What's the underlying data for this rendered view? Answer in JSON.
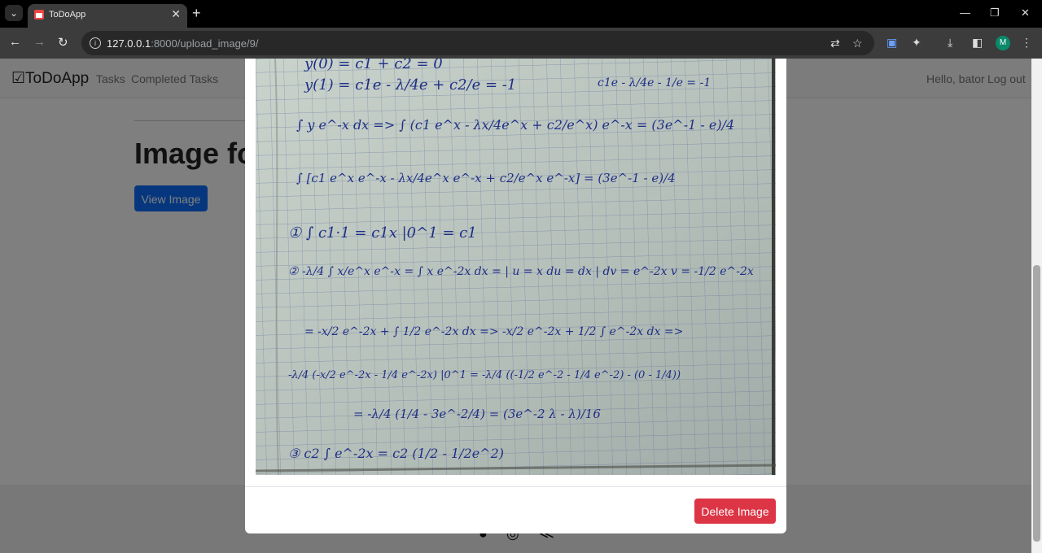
{
  "browser": {
    "tab_title": "ToDoApp",
    "url_host": "127.0.0.1",
    "url_path": ":8000/upload_image/9/",
    "profile_initial": "M"
  },
  "navbar": {
    "brand": "ToDoApp",
    "links": [
      "Tasks",
      "Completed Tasks"
    ],
    "greeting": "Hello, bator",
    "logout": "Log out"
  },
  "main": {
    "heading": "Image fo",
    "view_button": "View Image"
  },
  "modal": {
    "image_subject": "handwritten math notes on grid paper",
    "delete_button": "Delete Image",
    "notes": [
      "y(0) = c1 + c2 = 0",
      "y(1) = c1e - λ/4e + c2/e = -1",
      "c1e - λ/4e - 1/e = -1",
      "∫ y e^-x dx => ∫ (c1 e^x - λx/4e^x + c2/e^x) e^-x = (3e^-1 - e)/4",
      "∫ [c1 e^x e^-x - λx/4e^x e^-x + c2/e^x e^-x] = (3e^-1 - e)/4",
      "① ∫ c1·1 = c1x |0^1 = c1",
      "② -λ/4 ∫ x/e^x e^-x = ∫ x e^-2x dx = | u = x   du = dx | dv = e^-2x   v = -1/2 e^-2x",
      "= -x/2 e^-2x + ∫ 1/2 e^-2x dx => -x/2 e^-2x + 1/2 ∫ e^-2x dx =>",
      "-λ/4 (-x/2 e^-2x - 1/4 e^-2x) |0^1 = -λ/4 ((-1/2 e^-2 - 1/4 e^-2) - (0 - 1/4))",
      "= -λ/4 (1/4 - 3e^-2/4) = (3e^-2 λ - λ)/16",
      "③ c2 ∫ e^-2x = c2 (1/2 - 1/2e^2)"
    ]
  }
}
